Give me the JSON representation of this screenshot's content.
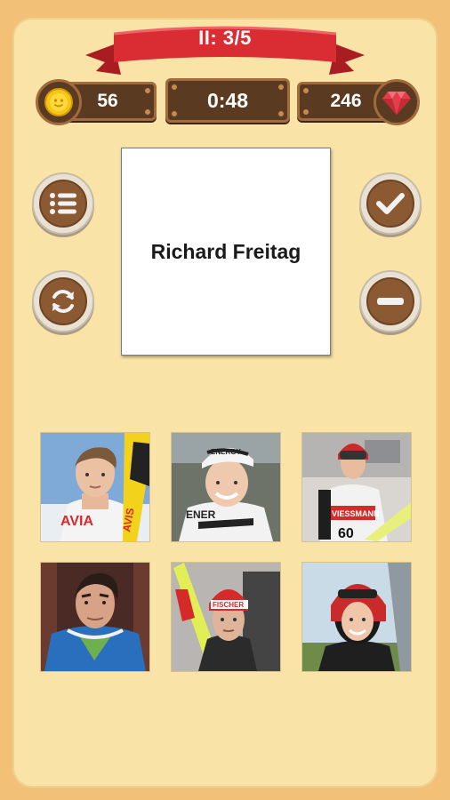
{
  "header": {
    "level_label": "II: 3/5",
    "coins": "56",
    "timer": "0:48",
    "gems": "246"
  },
  "icons": {
    "coin": "coin-icon",
    "gem": "gem-icon",
    "list": "list-icon",
    "refresh": "refresh-icon",
    "check": "check-icon",
    "minus": "minus-icon"
  },
  "colors": {
    "background": "#f3c078",
    "panel": "#f9e3a6",
    "ribbon": "#d92d33",
    "wood": "#5b3a22",
    "button_inner": "#8b5a33"
  },
  "question": {
    "name": "Richard Freitag"
  },
  "photos": [
    {
      "id": "photo-1",
      "caption_1": "AVIA",
      "caption_2": "AVIS"
    },
    {
      "id": "photo-2",
      "caption_1": "ENER",
      "caption_2": "ENERGY"
    },
    {
      "id": "photo-3",
      "caption_1": "VIESSMANN",
      "caption_2": "60"
    },
    {
      "id": "photo-4"
    },
    {
      "id": "photo-5",
      "caption_1": "FISCHER"
    },
    {
      "id": "photo-6"
    }
  ]
}
